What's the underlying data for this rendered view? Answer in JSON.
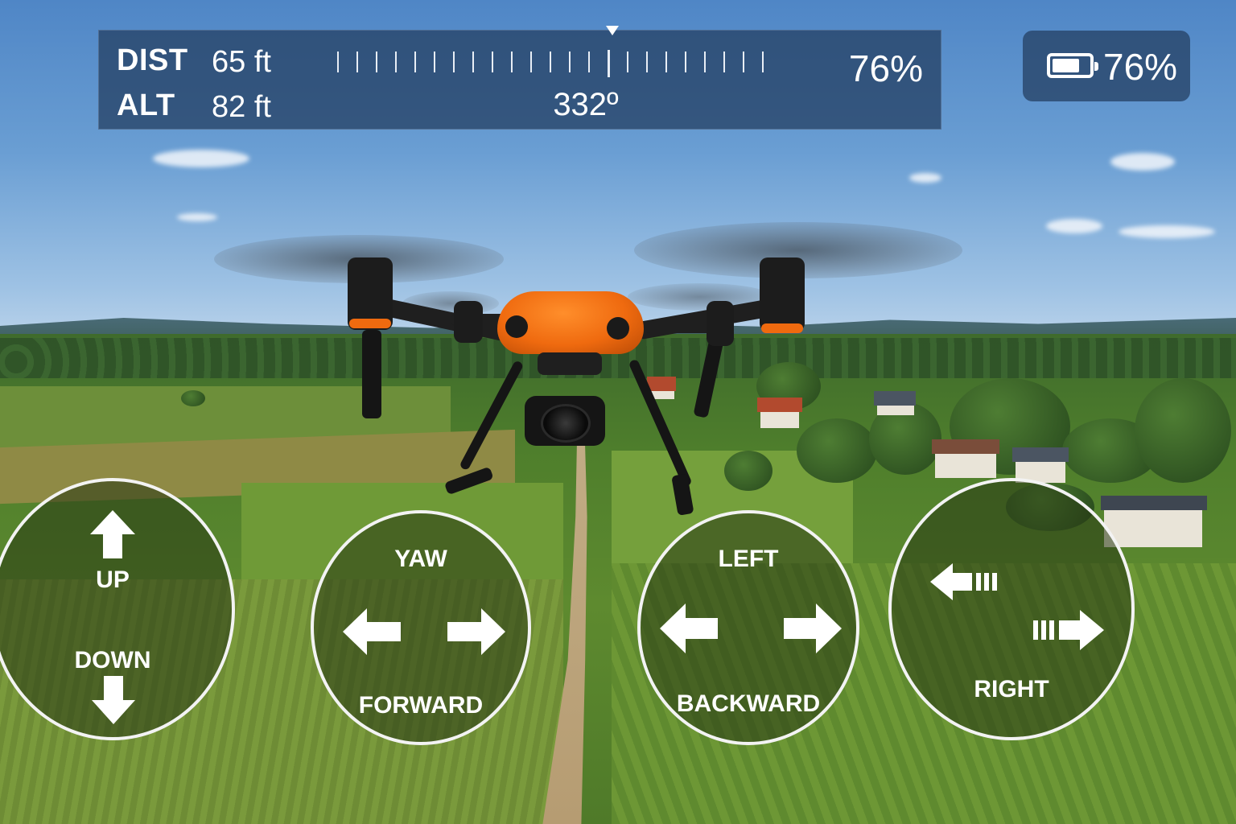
{
  "hud": {
    "dist_label": "DIST",
    "dist_value": "65 ft",
    "alt_label": "ALT",
    "alt_value": "82 ft",
    "heading": "332º",
    "bar_percent": "76%"
  },
  "battery": {
    "icon": "battery-icon",
    "level": 0.76,
    "text": "76%"
  },
  "controls": {
    "left_throttle": {
      "up_label": "UP",
      "down_label": "DOWN"
    },
    "yaw": {
      "top_label": "YAW",
      "bottom_label": "FORWARD"
    },
    "pitch": {
      "top_label": "LEFT",
      "bottom_label": "BACKWARD"
    },
    "roll": {
      "bottom_label": "RIGHT"
    }
  },
  "colors": {
    "hud_panel": "#264266",
    "drone_body": "#ef6a0f",
    "control_ring": "#f3f3f3"
  }
}
